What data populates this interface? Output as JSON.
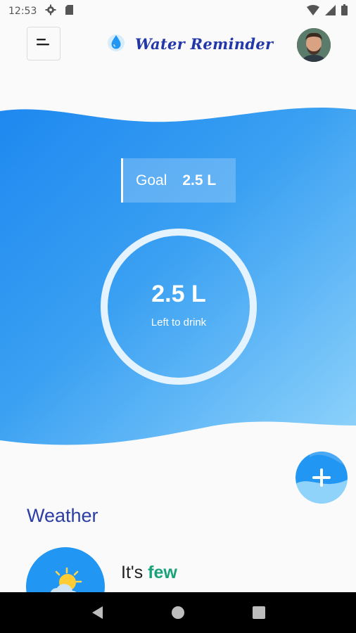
{
  "status_bar": {
    "time": "12:53",
    "icons": [
      "gear-icon",
      "sd-card-icon",
      "wifi-icon",
      "signal-icon",
      "battery-icon"
    ]
  },
  "app_bar": {
    "title": "Water Reminder",
    "icons": [
      "menu-icon",
      "water-drop-icon",
      "avatar"
    ]
  },
  "hero": {
    "goal_label": "Goal",
    "goal_value": "2.5 L",
    "remaining_value": "2.5 L",
    "remaining_caption": "Left to drink"
  },
  "fab": {
    "icon": "plus-icon"
  },
  "weather": {
    "heading": "Weather",
    "text_prefix": "It's",
    "text_accent": "few",
    "icon": "partly-cloudy-icon"
  },
  "nav_bar": {
    "icons": [
      "back-icon",
      "home-icon",
      "recents-icon"
    ]
  },
  "colors": {
    "wave_start": "#1e88f0",
    "wave_end": "#8fd3fb",
    "title": "#2237a8",
    "weather_heading": "#2c3ea3",
    "accent_green": "#1aa37a"
  }
}
